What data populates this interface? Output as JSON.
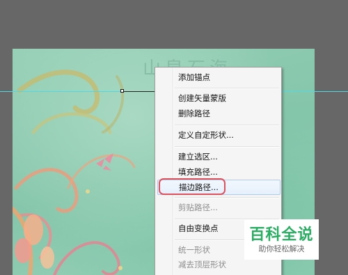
{
  "document": {
    "header_text": "山泉石海"
  },
  "context_menu": {
    "items": [
      {
        "label": "添加锚点",
        "enabled": true
      },
      {
        "label": "创建矢量蒙版",
        "enabled": true
      },
      {
        "label": "删除路径",
        "enabled": true
      },
      {
        "label": "定义自定形状...",
        "enabled": true
      },
      {
        "label": "建立选区...",
        "enabled": true
      },
      {
        "label": "填充路径...",
        "enabled": true
      },
      {
        "label": "描边路径...",
        "enabled": true,
        "hovered": true
      },
      {
        "label": "剪贴路径...",
        "enabled": false
      },
      {
        "label": "自由变换点",
        "enabled": true
      },
      {
        "label": "统一形状",
        "enabled": false
      },
      {
        "label": "减去顶层形状",
        "enabled": false
      }
    ]
  },
  "watermark": {
    "title": "百科全说",
    "subtitle": "助你轻松解决"
  },
  "colors": {
    "app_background": "#676767",
    "guide": "#4fd8e6",
    "highlight_ring": "#e0505a",
    "logo_green": "#27ae60"
  }
}
